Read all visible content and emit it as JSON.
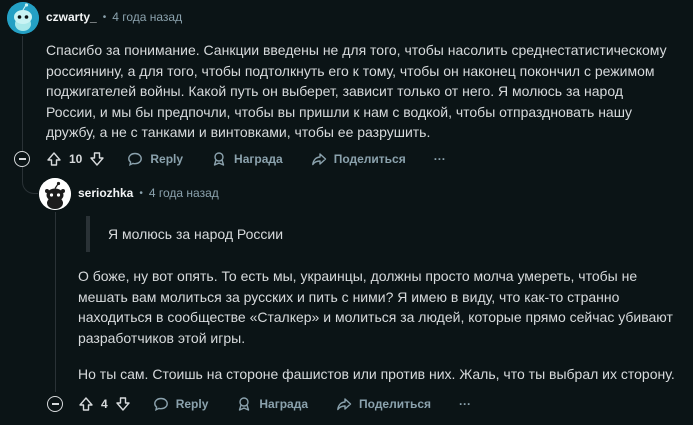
{
  "comments": [
    {
      "username": "czwarty_",
      "separator": "•",
      "time": "4 года назад",
      "lines": [
        "Спасибо за понимание. Санкции введены не для того, чтобы насолить среднестатистическому",
        "россиянину, а для того, чтобы подтолкнуть его к тому, чтобы он наконец покончил с режимом",
        "поджигателей войны. Какой путь он выберет, зависит только от него. Я молюсь за народ",
        "России, и мы бы предпочли, чтобы вы пришли к нам с водкой, чтобы отпраздновать нашу",
        "дружбу, а не с танками и винтовками, чтобы ее разрушить."
      ],
      "votes": "10",
      "reply": "Reply",
      "award": "Награда",
      "share": "Поделиться",
      "more": "···"
    },
    {
      "username": "seriozhka",
      "separator": "•",
      "time": "4 года назад",
      "quote": "Я молюсь за народ России",
      "lines": [
        "О боже, ну вот опять. То есть мы, украинцы, должны просто молча умереть, чтобы не",
        "мешать вам молиться за русских и пить с ними? Я имею в виду, что как-то странно",
        "находиться в сообществе «Сталкер» и молиться за людей, которые прямо сейчас убивают",
        "разработчиков этой игры."
      ],
      "paragraph2": "Но ты сам. Стоишь на стороне фашистов или против них. Жаль, что ты выбрал их сторону.",
      "votes": "4",
      "reply": "Reply",
      "award": "Награда",
      "share": "Поделиться",
      "more": "···"
    }
  ],
  "colors": {
    "background": "#0b1416",
    "text": "#d7dadc",
    "muted": "#8ba2ad",
    "thread": "#2a3236",
    "avatar1_bg": "#24a0c4",
    "avatar2_bg": "#ffffff"
  }
}
